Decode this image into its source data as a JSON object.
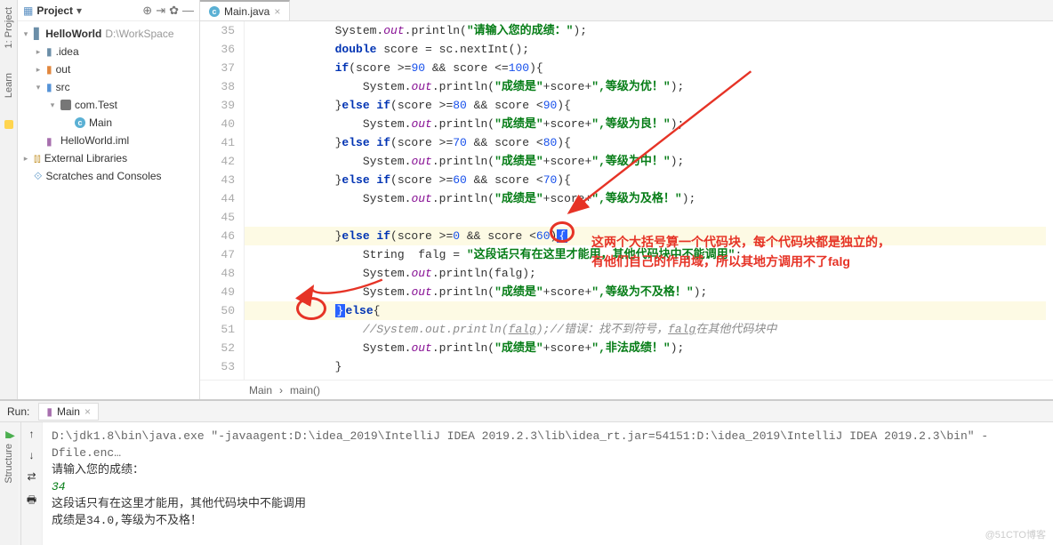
{
  "sidebar": {
    "title": "Project",
    "project_name": "HelloWorld",
    "project_path": "D:\\WorkSpace",
    "nodes": {
      "idea": ".idea",
      "out": "out",
      "src": "src",
      "pkg": "com.Test",
      "main": "Main",
      "iml": "HelloWorld.iml",
      "ext": "External Libraries",
      "scratch": "Scratches and Consoles"
    }
  },
  "vtabs": {
    "project": "1: Project",
    "learn": "Learn",
    "structure": "Structure"
  },
  "editor": {
    "tab": "Main.java",
    "breadcrumb": [
      "Main",
      "main()"
    ],
    "lines": {
      "start": 35,
      "end": 53
    },
    "code": {
      "l35": {
        "pre": "            System.",
        "f": "out",
        "m": ".println(",
        "s": "\"请输入您的成绩：\"",
        "post": ");"
      },
      "l36": {
        "kw1": "double",
        "mid": " score = sc.nextInt();"
      },
      "l37": {
        "kw": "if",
        "cond": "(score >=",
        "n1": "90",
        "mid": " && score <=",
        "n2": "100",
        "end": "){"
      },
      "l38": {
        "pre": "                System.",
        "f": "out",
        "m": ".println(",
        "s1": "\"成绩是\"",
        "mid": "+score+",
        "s2": "\",等级为优！\"",
        "post": ");"
      },
      "l39": {
        "pre": "            }",
        "kw": "else if",
        "cond": "(score >=",
        "n1": "80",
        "mid": " && score <",
        "n2": "90",
        "end": "){"
      },
      "l40": {
        "pre": "                System.",
        "f": "out",
        "m": ".println(",
        "s1": "\"成绩是\"",
        "mid": "+score+",
        "s2": "\",等级为良！\"",
        "post": ");"
      },
      "l41": {
        "pre": "            }",
        "kw": "else if",
        "cond": "(score >=",
        "n1": "70",
        "mid": " && score <",
        "n2": "80",
        "end": "){"
      },
      "l42": {
        "pre": "                System.",
        "f": "out",
        "m": ".println(",
        "s1": "\"成绩是\"",
        "mid": "+score+",
        "s2": "\",等级为中！\"",
        "post": ");"
      },
      "l43": {
        "pre": "            }",
        "kw": "else if",
        "cond": "(score >=",
        "n1": "60",
        "mid": " && score <",
        "n2": "70",
        "end": "){"
      },
      "l44": {
        "pre": "                System.",
        "f": "out",
        "m": ".println(",
        "s1": "\"成绩是\"",
        "mid": "+score+",
        "s2": "\",等级为及格！\"",
        "post": ");"
      },
      "l46": {
        "pre": "            }",
        "kw": "else if",
        "cond": "(score >=",
        "n1": "0",
        "mid": " && score <",
        "n2": "60",
        "end": ")",
        "brace": "{"
      },
      "l47": {
        "pre": "                String  falg = ",
        "s": "\"这段话只有在这里才能用，其他代码块中不能调用\"",
        "post": ";"
      },
      "l48": {
        "pre": "                System.",
        "f": "out",
        "m": ".println(falg);"
      },
      "l49": {
        "pre": "                System.",
        "f": "out",
        "m": ".println(",
        "s1": "\"成绩是\"",
        "mid": "+score+",
        "s2": "\",等级为不及格！\"",
        "post": ");"
      },
      "l50": {
        "pre": "            ",
        "brace": "}",
        "kw": "else",
        "end": "{"
      },
      "l51": {
        "cmt": "                //System.out.println(falg);//错误：找不到符号，falg在其他代码块中"
      },
      "l52": {
        "pre": "                System.",
        "f": "out",
        "m": ".println(",
        "s1": "\"成绩是\"",
        "mid": "+score+",
        "s2": "\",非法成绩！\"",
        "post": ");"
      },
      "l53": {
        "txt": "            }"
      }
    },
    "annotation": {
      "line1": "这两个大括号算一个代码块，每个代码块都是独立的，",
      "line2": "有他们自己的作用域，所以其地方调用不了falg"
    }
  },
  "run": {
    "label": "Run:",
    "tab": "Main",
    "lines": [
      "D:\\jdk1.8\\bin\\java.exe \"-javaagent:D:\\idea_2019\\IntelliJ IDEA 2019.2.3\\lib\\idea_rt.jar=54151:D:\\idea_2019\\IntelliJ IDEA 2019.2.3\\bin\" -Dfile.enc…",
      "请输入您的成绩：",
      "34",
      "这段话只有在这里才能用，其他代码块中不能调用",
      "成绩是34.0,等级为不及格！"
    ]
  },
  "watermark": "@51CTO博客"
}
